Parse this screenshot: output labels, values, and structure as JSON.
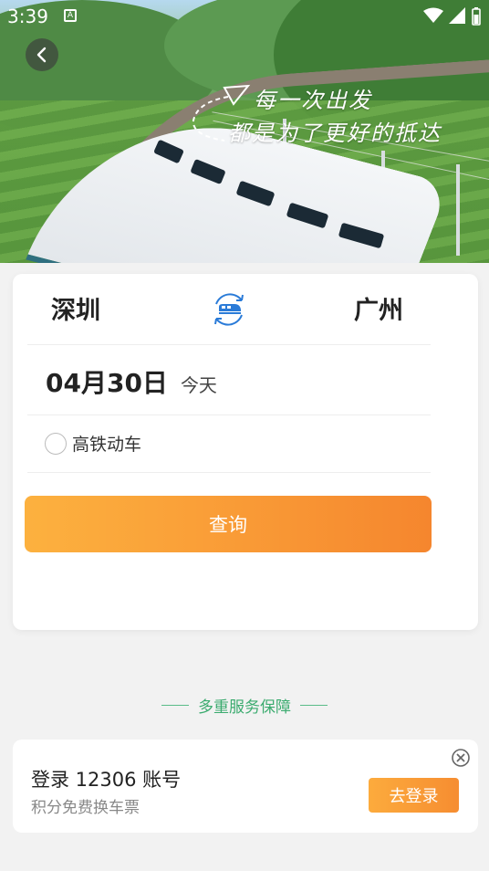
{
  "status": {
    "time": "3:39",
    "app_badge": "A"
  },
  "banner": {
    "slogan_line1": "每一次出发",
    "slogan_line2": "都是为了更好的抵达"
  },
  "search": {
    "from_city": "深圳",
    "to_city": "广州",
    "date": "04月30日",
    "date_label": "今天",
    "option_label": "高铁动车",
    "option_checked": false,
    "query_label": "查询"
  },
  "services": {
    "heading": "多重服务保障"
  },
  "login": {
    "title": "登录 12306 账号",
    "subtitle": "积分免费换车票",
    "button_label": "去登录"
  },
  "colors": {
    "accent_orange": "#f99a36",
    "service_green": "#3bab6f",
    "swap_blue": "#2a7bd8"
  }
}
